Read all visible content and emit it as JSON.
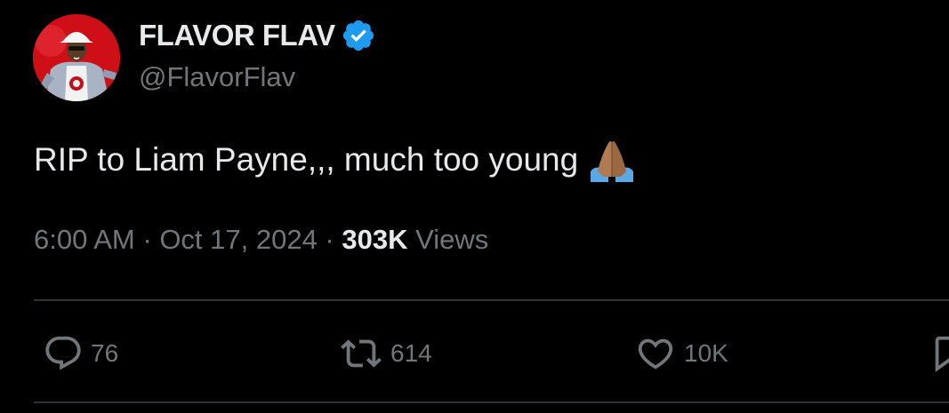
{
  "author": {
    "display_name": "FLAVOR FLAV",
    "handle": "@FlavorFlav",
    "verified_icon": "verified-badge-icon",
    "avatar_icon": "avatar-photo"
  },
  "tweet": {
    "text": "RIP to Liam Payne,,, much too young",
    "emoji_icon": "folded-hands-emoji"
  },
  "meta": {
    "time": "6:00 AM",
    "separator": "·",
    "date": "Oct 17, 2024",
    "views_count": "303K",
    "views_label": "Views"
  },
  "actions": {
    "reply": {
      "icon": "reply-icon",
      "count": "76"
    },
    "repost": {
      "icon": "repost-icon",
      "count": "614"
    },
    "like": {
      "icon": "heart-icon",
      "count": "10K"
    },
    "bookmark": {
      "icon": "bookmark-icon"
    }
  },
  "colors": {
    "background": "#000000",
    "primary_text": "#e7e9ea",
    "secondary_text": "#71767b",
    "divider": "#2f3336",
    "verified_blue": "#1d9bf0",
    "avatar_bg": "#d0101a"
  }
}
